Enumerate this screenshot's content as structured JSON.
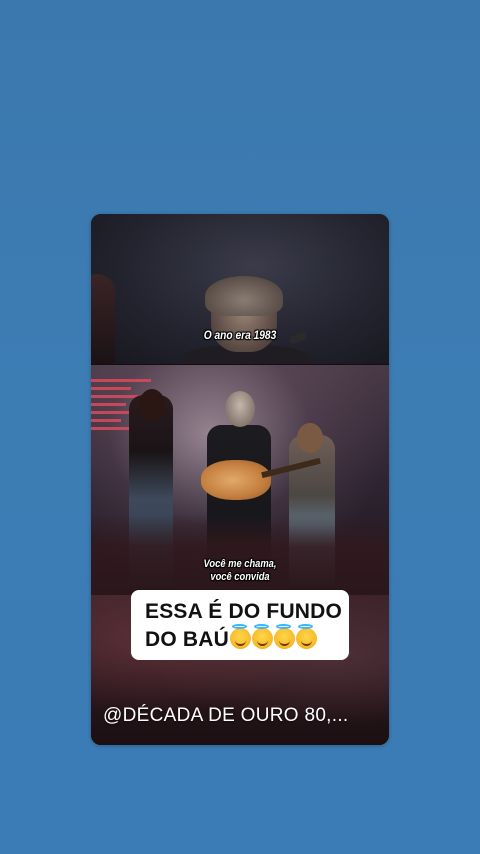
{
  "story": {
    "subtitle_top": "O ano era 1983",
    "subtitle_stage_line1": "Você me chama,",
    "subtitle_stage_line2": "você convida",
    "caption_line1": "ESSA É DO FUNDO",
    "caption_line2": "DO BAÚ",
    "caption_emoji": "smiling-face-with-halo",
    "caption_emoji_count": 4,
    "handle": "@DÉCADA  DE OURO 80,..."
  },
  "colors": {
    "background": "#3c7db4",
    "caption_bg": "#ffffff",
    "caption_text": "#111111"
  }
}
